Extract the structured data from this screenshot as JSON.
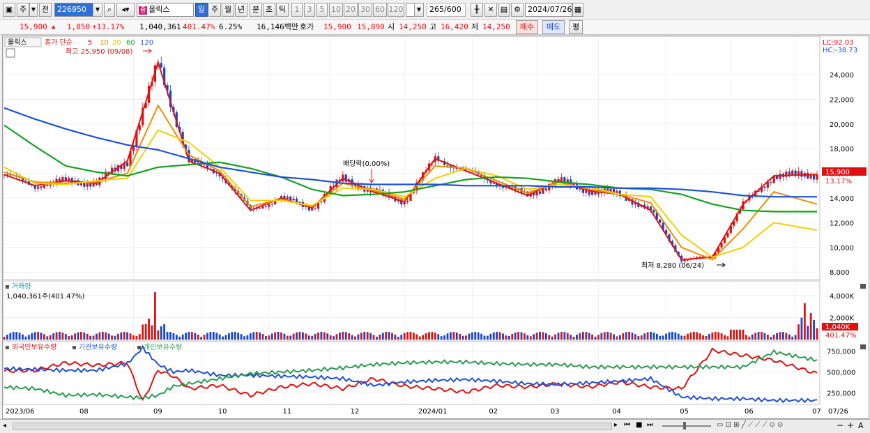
{
  "toolbar": {
    "buttons": [
      "주",
      "전"
    ],
    "stock_code": "226950",
    "stock_name": "올릭스",
    "periods": [
      "일",
      "주",
      "월",
      "년",
      "분",
      "초",
      "틱"
    ],
    "period_selected": "일",
    "numbers": [
      "1",
      "3",
      "5",
      "10",
      "20",
      "30",
      "60",
      "120"
    ],
    "count": "265",
    "count_total": "/600",
    "date": "2024/07/26"
  },
  "quote": {
    "price": "15,900",
    "change": "1,850",
    "change_pct": "+13.17%",
    "volume": "1,040,361",
    "volume_pct": "401.47%",
    "turnover": "6.25%",
    "amount": "16,146백만",
    "ask_label": "호가",
    "ask": "15,900",
    "bid": "15,890",
    "open_label": "시",
    "open": "14,250",
    "high_label": "고",
    "high": "16,420",
    "low_label": "저",
    "low": "14,250",
    "buy_label": "매수",
    "sell_label": "매도",
    "eval_label": "평"
  },
  "price_panel": {
    "name_tag": "올릭스",
    "legend_prefix": "종가 단순",
    "ma_labels": [
      "5",
      "10",
      "20",
      "60",
      "120"
    ],
    "lc": "LC:92.03",
    "hc": "HC:-38.73",
    "max_label": "최고 25,950 (09/08)",
    "min_label": "최저 8,280 (06/24)",
    "dividend_label": "배당락(0.00%)",
    "last_price_tag": "15,900",
    "last_pct_tag": "13.17%"
  },
  "volume_panel": {
    "title": "거래량",
    "value": "1,040,361주(401.47%)",
    "tag": "1,040K",
    "pct_tag": "401.47%"
  },
  "holding_panel": {
    "series": [
      "외국인보유수량",
      "기관보유수량",
      "개인보유수량"
    ]
  },
  "x_axis_labels": [
    "2023/06",
    "08",
    "09",
    "10",
    "11",
    "12",
    "2024/01",
    "02",
    "03",
    "04",
    "05",
    "06",
    "07",
    "07/26"
  ],
  "colors": {
    "ma5": "#e01010",
    "ma10": "#f08c00",
    "ma20": "#f0d000",
    "ma60": "#16a020",
    "ma120": "#1e50d8",
    "up": "#e01010",
    "down": "#1646c8",
    "foreign": "#e01010",
    "institution": "#2050d8",
    "individual": "#2a9a50"
  },
  "chart_data": [
    {
      "type": "line",
      "title": "",
      "ylim": [
        7500,
        27000
      ],
      "yticks": [
        "24,000",
        "22,000",
        "20,000",
        "18,000",
        "16,000",
        "14,000",
        "12,000",
        "10,000",
        "8,000"
      ],
      "yvals": [
        24000,
        22000,
        20000,
        18000,
        16000,
        14000,
        12000,
        10000,
        8000
      ],
      "x": [
        0,
        10,
        20,
        30,
        40,
        50,
        60,
        70,
        80,
        90,
        100,
        110,
        120,
        130,
        140,
        150,
        160,
        170,
        180,
        190,
        200,
        210,
        220,
        230,
        240,
        250,
        264
      ],
      "series": [
        {
          "name": "5",
          "values": [
            15900,
            15000,
            15400,
            15200,
            17000,
            25000,
            17000,
            16000,
            13000,
            14000,
            13200,
            15600,
            14500,
            13700,
            17200,
            16200,
            15200,
            14200,
            15400,
            14600,
            14300,
            13000,
            9000,
            9200,
            13500,
            15800,
            15900
          ]
        },
        {
          "name": "10",
          "values": [
            16100,
            15300,
            15200,
            15300,
            16000,
            21500,
            17500,
            16200,
            13300,
            13900,
            13300,
            15200,
            14600,
            13900,
            16600,
            16400,
            15400,
            14400,
            15300,
            14700,
            14300,
            13600,
            10000,
            9000,
            11500,
            14500,
            13500
          ]
        },
        {
          "name": "20",
          "values": [
            16500,
            15200,
            15100,
            15400,
            15600,
            19500,
            18500,
            16500,
            13800,
            13800,
            13400,
            14800,
            14700,
            14100,
            15600,
            16400,
            15800,
            14700,
            15100,
            14900,
            14300,
            14100,
            11000,
            9200,
            10000,
            12000,
            11400
          ]
        },
        {
          "name": "60",
          "values": [
            19900,
            18200,
            16600,
            16100,
            15800,
            16500,
            16700,
            16900,
            16400,
            15700,
            14700,
            14200,
            14300,
            14500,
            15000,
            15500,
            15700,
            15600,
            15300,
            15100,
            14800,
            14700,
            14300,
            13500,
            13000,
            12900,
            12900
          ]
        },
        {
          "name": "120",
          "values": [
            21300,
            20400,
            19600,
            18900,
            18300,
            17900,
            17200,
            16500,
            16100,
            15700,
            15500,
            15200,
            15100,
            15100,
            15100,
            15000,
            15000,
            15000,
            14900,
            14900,
            14800,
            14800,
            14700,
            14500,
            14200,
            14100,
            14100
          ]
        }
      ]
    },
    {
      "type": "bar",
      "title": "거래량",
      "ylim": [
        0,
        5000
      ],
      "yticks": [
        "4,000K",
        "2,000K"
      ],
      "yvals": [
        4000,
        2000
      ],
      "note": "daily volume in thousands of shares"
    },
    {
      "type": "line",
      "title": "",
      "ylim": [
        120000,
        830000
      ],
      "yticks": [
        "750,000",
        "500,000",
        "250,000"
      ],
      "yvals": [
        750000,
        500000,
        250000
      ],
      "x": [
        0,
        10,
        20,
        30,
        40,
        45,
        50,
        55,
        60,
        70,
        80,
        90,
        100,
        110,
        120,
        130,
        140,
        150,
        160,
        170,
        180,
        190,
        200,
        210,
        220,
        230,
        240,
        250,
        264
      ],
      "series": [
        {
          "name": "외국인보유수량",
          "values": [
            510000,
            520000,
            610000,
            580000,
            610000,
            150000,
            520000,
            450000,
            300000,
            340000,
            220000,
            320000,
            360000,
            300000,
            420000,
            330000,
            300000,
            260000,
            340000,
            320000,
            360000,
            320000,
            380000,
            320000,
            300000,
            760000,
            700000,
            640000,
            480000
          ]
        },
        {
          "name": "기관보유수량",
          "values": [
            540000,
            530000,
            520000,
            520000,
            600000,
            790000,
            590000,
            500000,
            520000,
            460000,
            460000,
            450000,
            440000,
            420000,
            340000,
            380000,
            400000,
            410000,
            390000,
            360000,
            350000,
            370000,
            390000,
            420000,
            200000,
            180000,
            180000,
            160000,
            160000
          ]
        },
        {
          "name": "개인보유수량",
          "values": [
            320000,
            300000,
            220000,
            230000,
            200000,
            190000,
            220000,
            330000,
            360000,
            420000,
            480000,
            500000,
            520000,
            550000,
            590000,
            610000,
            620000,
            620000,
            600000,
            590000,
            590000,
            560000,
            560000,
            560000,
            560000,
            560000,
            560000,
            740000,
            640000
          ]
        }
      ]
    }
  ]
}
